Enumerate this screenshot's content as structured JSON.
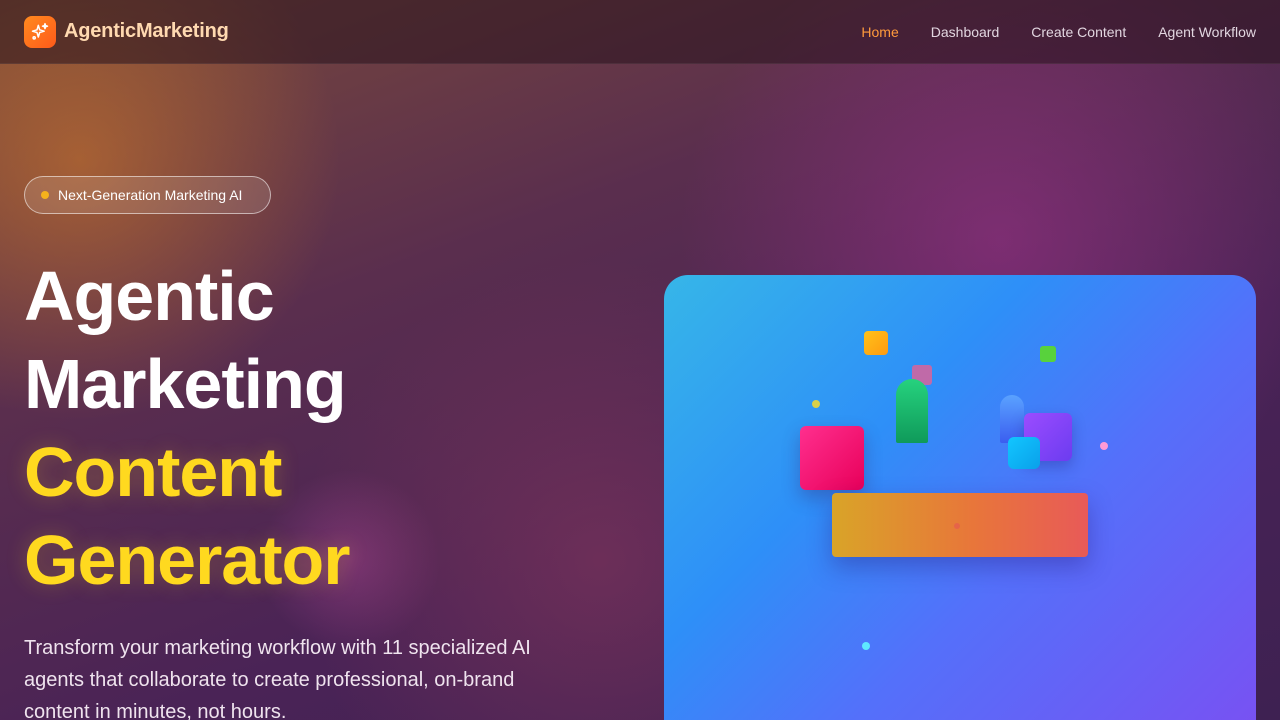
{
  "app": {
    "brand": "AgenticMarketing"
  },
  "nav": {
    "items": [
      {
        "label": "Home",
        "active": true
      },
      {
        "label": "Dashboard",
        "active": false
      },
      {
        "label": "Create Content",
        "active": false
      },
      {
        "label": "Agent Workflow",
        "active": false
      }
    ]
  },
  "hero": {
    "badge": "Next-Generation Marketing AI",
    "title_line1": "Agentic",
    "title_line2": "Marketing",
    "title_line3": "Content",
    "title_line4": "Generator",
    "description": "Transform your marketing workflow with 11 specialized AI agents that collaborate to create professional, on-brand content in minutes, not hours."
  },
  "colors": {
    "accent": "#ff9a3c",
    "highlight": "#ffd91f",
    "logo": "#ff6a1a"
  },
  "icons": {
    "logo": "sparkles-icon"
  }
}
